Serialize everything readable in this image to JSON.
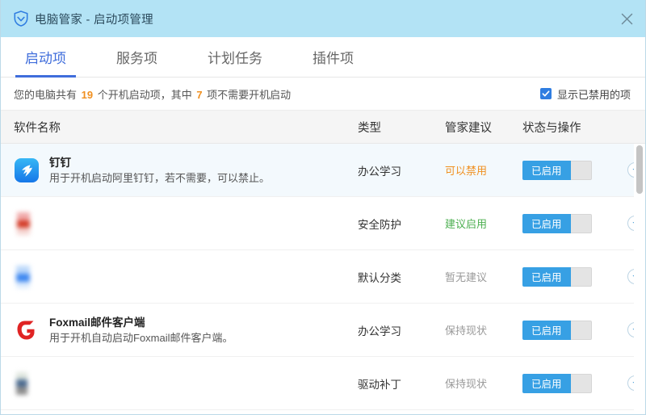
{
  "window": {
    "title": "电脑管家 - 启动项管理",
    "logo_icon": "shield-check-icon",
    "close_icon": "close-icon"
  },
  "tabs": [
    {
      "label": "启动项",
      "active": true
    },
    {
      "label": "服务项",
      "active": false
    },
    {
      "label": "计划任务",
      "active": false
    },
    {
      "label": "插件项",
      "active": false
    }
  ],
  "infobar": {
    "text_part1": "您的电脑共有 ",
    "total_count": "19",
    "text_part2": " 个开机启动项，其中 ",
    "unneeded_count": "7",
    "text_part3": " 项不需要开机启动",
    "show_disabled_label": "显示已禁用的项",
    "show_disabled_checked": true,
    "check_icon": "check-icon",
    "accent_number_color": "#f09021"
  },
  "table": {
    "headers": {
      "name": "软件名称",
      "type": "类型",
      "advice": "管家建议",
      "status": "状态与操作"
    },
    "rows": [
      {
        "icon": "dingtalk-icon",
        "censored": false,
        "title": "钉钉",
        "desc": "用于开机启动阿里钉钉，若不需要，可以禁止。",
        "type": "办公学习",
        "advice": "可以禁用",
        "advice_color": "#f09021",
        "toggle_label": "已启用",
        "more_icon": "chevron-down-icon",
        "highlighted": true
      },
      {
        "icon": "censored-red-icon",
        "censored": true,
        "title": "",
        "desc": "",
        "type": "安全防护",
        "advice": "建议启用",
        "advice_color": "#4caf50",
        "toggle_label": "已启用",
        "more_icon": "chevron-down-icon",
        "highlighted": false
      },
      {
        "icon": "censored-blue-icon",
        "censored": true,
        "title": "",
        "desc": "",
        "type": "默认分类",
        "advice": "暂无建议",
        "advice_color": "#999999",
        "toggle_label": "已启用",
        "more_icon": "chevron-down-icon",
        "highlighted": false
      },
      {
        "icon": "foxmail-icon",
        "censored": false,
        "title": "Foxmail邮件客户端",
        "desc": "用于开机自动启动Foxmail邮件客户端。",
        "type": "办公学习",
        "advice": "保持现状",
        "advice_color": "#999999",
        "toggle_label": "已启用",
        "more_icon": "chevron-down-icon",
        "highlighted": false
      },
      {
        "icon": "censored-dark-icon",
        "censored": true,
        "title": "",
        "desc": "",
        "type": "驱动补丁",
        "advice": "保持现状",
        "advice_color": "#999999",
        "toggle_label": "已启用",
        "more_icon": "chevron-down-icon",
        "highlighted": false
      }
    ]
  },
  "scrollbar": {
    "name": "vertical-scrollbar"
  }
}
